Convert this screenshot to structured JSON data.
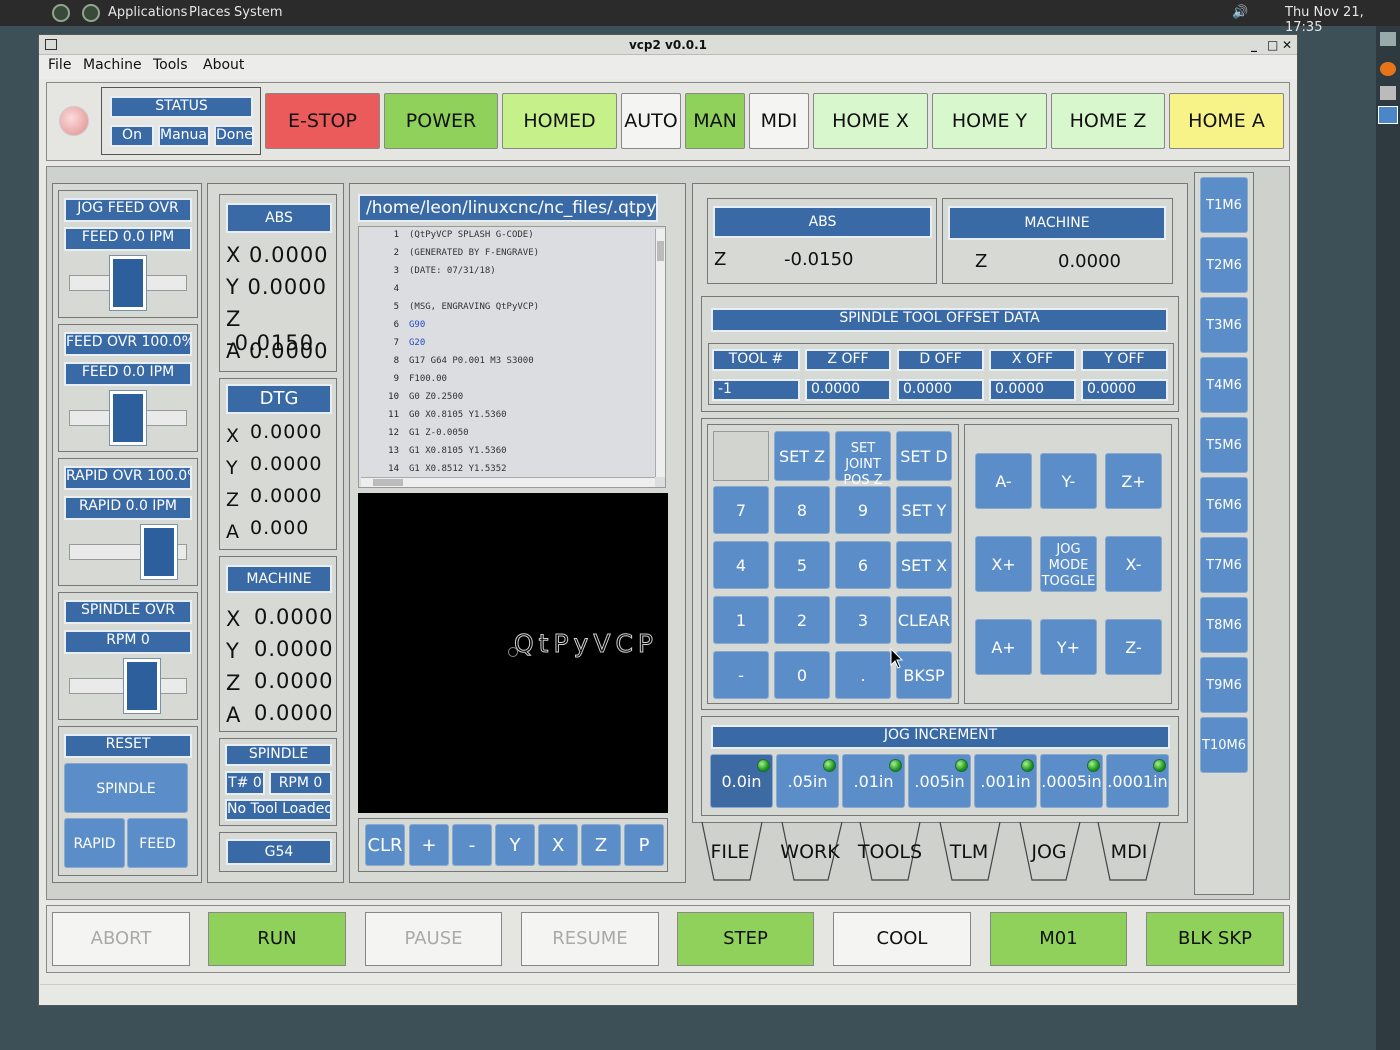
{
  "system_bar": {
    "menus": [
      "Applications",
      "Places",
      "System"
    ],
    "clock": "Thu Nov 21, 17:35"
  },
  "window": {
    "title": "vcp2 v0.0.1",
    "menu": [
      "File",
      "Machine",
      "Tools",
      "About"
    ]
  },
  "status": {
    "title": "STATUS",
    "fields": [
      "On",
      "Manual",
      "Done"
    ]
  },
  "top_buttons": [
    {
      "label": "E-STOP",
      "color": "#ec5b5b"
    },
    {
      "label": "POWER",
      "color": "#8fd15a"
    },
    {
      "label": "HOMED",
      "color": "#c6f08a"
    },
    {
      "label": "AUTO",
      "color": "#f4f4f2"
    },
    {
      "label": "MAN",
      "color": "#8fd15a"
    },
    {
      "label": "MDI",
      "color": "#f4f4f2"
    },
    {
      "label": "HOME X",
      "color": "#d9f7cc"
    },
    {
      "label": "HOME Y",
      "color": "#d9f7cc"
    },
    {
      "label": "HOME Z",
      "color": "#d9f7cc"
    },
    {
      "label": "HOME A",
      "color": "#f7f389"
    }
  ],
  "overrides": {
    "jog": {
      "title": "JOG FEED OVR",
      "value": "FEED 0.0  IPM",
      "level": 0.5
    },
    "feed": {
      "title": "FEED OVR 100.0%",
      "value": "FEED 0.0  IPM",
      "level": 0.5
    },
    "rapid": {
      "title": "RAPID OVR 100.0%",
      "value": "RAPID 0.0  IPM",
      "level": 0.75
    },
    "spindle": {
      "title": "SPINDLE OVR",
      "value": "RPM 0",
      "level": 0.6
    },
    "reset": "RESET",
    "spindle_btn": "SPINDLE",
    "rapid_btn": "RAPID",
    "feed_btn": "FEED"
  },
  "dro": {
    "abs_title": "ABS",
    "abs": [
      "X 0.0000",
      "Y 0.0000",
      "Z -0.0150",
      "A 0.0000"
    ],
    "dtg_title": "DTG",
    "dtg_axes": [
      "X",
      "Y",
      "Z",
      "A"
    ],
    "dtg_vals": [
      "0.0000",
      "0.0000",
      "0.0000",
      "0.000"
    ],
    "mach_title": "MACHINE",
    "mach_axes": [
      "X",
      "Y",
      "Z",
      "A"
    ],
    "mach_vals": [
      "0.0000",
      "0.0000",
      "0.0000",
      "0.0000"
    ],
    "spindle_title": "SPINDLE",
    "tool": "T# 0",
    "rpm": "RPM 0",
    "tool_loaded": "No Tool Loaded",
    "wcs": "G54"
  },
  "gcode": {
    "path": "/home/leon/linuxcnc/nc_files/.qtpyvcp",
    "lines": [
      {
        "n": "1",
        "t": "(QtPyVCP SPLASH G-CODE)"
      },
      {
        "n": "2",
        "t": "(GENERATED BY F-ENGRAVE)"
      },
      {
        "n": "3",
        "t": "(DATE: 07/31/18)"
      },
      {
        "n": "4",
        "t": ""
      },
      {
        "n": "5",
        "t": "(MSG, ENGRAVING QtPyVCP)"
      },
      {
        "n": "6",
        "t": "G90"
      },
      {
        "n": "7",
        "t": "G20"
      },
      {
        "n": "8",
        "t": "G17 G64 P0.001 M3 S3000"
      },
      {
        "n": "9",
        "t": "F100.00"
      },
      {
        "n": "10",
        "t": "G0 Z0.2500"
      },
      {
        "n": "11",
        "t": "G0 X0.8105 Y1.5360"
      },
      {
        "n": "12",
        "t": "G1 Z-0.0050"
      },
      {
        "n": "13",
        "t": "G1 X0.8105 Y1.5360"
      },
      {
        "n": "14",
        "t": "G1 X0.8512 Y1.5352"
      }
    ]
  },
  "preview": {
    "text": "QtPyVCP"
  },
  "view_buttons": [
    "CLR",
    "+",
    "-",
    "Y",
    "X",
    "Z",
    "P"
  ],
  "offsets": {
    "abs_title": "ABS",
    "abs_axis": "Z",
    "abs_val": "-0.0150",
    "mach_title": "MACHINE",
    "mach_axis": "Z",
    "mach_val": "0.0000"
  },
  "tool_data": {
    "title": "SPINDLE TOOL OFFSET DATA",
    "headers": [
      "TOOL #",
      "Z OFF",
      "D OFF",
      "X OFF",
      "Y OFF"
    ],
    "values": [
      "-1",
      "0.0000",
      "0.0000",
      "0.0000",
      "0.0000"
    ]
  },
  "keypad": {
    "set_z": "SET Z",
    "set_joint": "SET JOINT POS Z",
    "set_d": "SET D",
    "keys": [
      "7",
      "8",
      "9",
      "SET Y",
      "4",
      "5",
      "6",
      "SET X",
      "1",
      "2",
      "3",
      "CLEAR",
      "-",
      "0",
      ".",
      "BKSP"
    ]
  },
  "jog": {
    "a_minus": "A-",
    "y_minus": "Y-",
    "z_plus": "Z+",
    "x_plus": "X+",
    "toggle": "JOG MODE TOGGLE",
    "x_minus": "X-",
    "a_plus": "A+",
    "y_plus": "Y+",
    "z_minus": "Z-"
  },
  "jog_increment": {
    "title": "JOG INCREMENT",
    "values": [
      "0.0in",
      ".05in",
      ".01in",
      ".005in",
      ".001in",
      ".0005in",
      ".0001in"
    ]
  },
  "tabs": [
    "FILE",
    "WORK",
    "TOOLS",
    "TLM",
    "JOG",
    "MDI"
  ],
  "tools": [
    "T1M6",
    "T2M6",
    "T3M6",
    "T4M6",
    "T5M6",
    "T6M6",
    "T7M6",
    "T8M6",
    "T9M6",
    "T10M6"
  ],
  "bottom_buttons": [
    {
      "label": "ABORT",
      "color": "#f4f4f2",
      "disabled": true
    },
    {
      "label": "RUN",
      "color": "#8fd15a"
    },
    {
      "label": "PAUSE",
      "color": "#f4f4f2",
      "disabled": true
    },
    {
      "label": "RESUME",
      "color": "#f4f4f2",
      "disabled": true
    },
    {
      "label": "STEP",
      "color": "#8fd15a"
    },
    {
      "label": "COOL",
      "color": "#f4f4f2"
    },
    {
      "label": "M01",
      "color": "#8fd15a"
    },
    {
      "label": "BLK SKP",
      "color": "#8fd15a"
    }
  ]
}
